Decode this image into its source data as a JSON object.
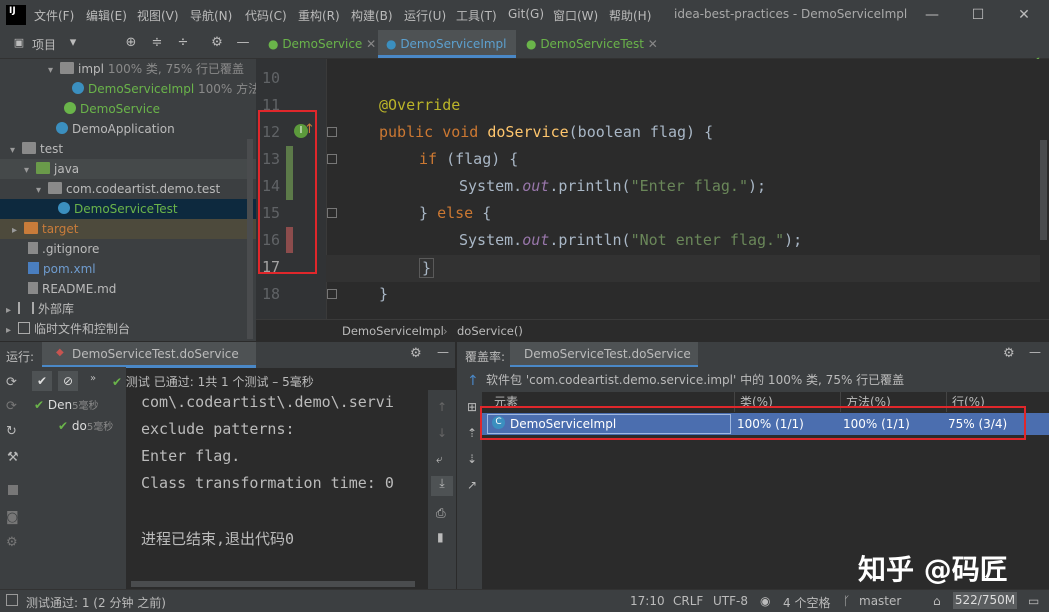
{
  "title_bar": {
    "menu": [
      "文件(F)",
      "编辑(E)",
      "视图(V)",
      "导航(N)",
      "代码(C)",
      "重构(R)",
      "构建(B)",
      "运行(U)",
      "工具(T)",
      "Git(G)",
      "窗口(W)",
      "帮助(H)"
    ],
    "window_title": "idea-best-practices - DemoServiceImpl"
  },
  "toolbar": {
    "project_label": "项目",
    "tabs": [
      "DemoService",
      "DemoServiceImpl",
      "DemoServiceTest"
    ],
    "active_tab": "DemoServiceImpl"
  },
  "project_tree": [
    {
      "label": "impl",
      "extra": "100% 类, 75% 行已覆盖",
      "type": "folder"
    },
    {
      "label": "DemoServiceImpl",
      "extra": "100% 方法",
      "type": "class"
    },
    {
      "label": "DemoService",
      "extra": "",
      "type": "interface"
    },
    {
      "label": "DemoApplication",
      "extra": "",
      "type": "spring"
    },
    {
      "label": "test",
      "extra": "",
      "type": "folder"
    },
    {
      "label": "java",
      "extra": "",
      "type": "folder-green"
    },
    {
      "label": "com.codeartist.demo.test",
      "extra": "",
      "type": "folder"
    },
    {
      "label": "DemoServiceTest",
      "extra": "",
      "type": "class"
    },
    {
      "label": "target",
      "extra": "",
      "type": "folder-orange"
    },
    {
      "label": ".gitignore",
      "extra": "",
      "type": "file"
    },
    {
      "label": "pom.xml",
      "extra": "",
      "type": "maven"
    },
    {
      "label": "README.md",
      "extra": "",
      "type": "file"
    },
    {
      "label": "外部库",
      "extra": "",
      "type": "lib"
    },
    {
      "label": "临时文件和控制台",
      "extra": "",
      "type": "lib"
    }
  ],
  "editor": {
    "line_numbers": [
      "10",
      "11",
      "12",
      "13",
      "14",
      "15",
      "16",
      "17",
      "18"
    ],
    "lines": {
      "l11": "@Override",
      "l12_kw1": "public",
      "l12_kw2": "void",
      "l12_fn": "doService",
      "l12_rest": "(boolean flag) {",
      "l13_kw": "if",
      "l13_rest": " (flag) {",
      "l14_a": "System.",
      "l14_b": "out",
      "l14_c": ".println(",
      "l14_str": "\"Enter flag.\"",
      "l14_end": ");",
      "l15_a": "} ",
      "l15_kw": "else",
      "l15_b": " {",
      "l16_a": "System.",
      "l16_b": "out",
      "l16_c": ".println(",
      "l16_str": "\"Not enter flag.\"",
      "l16_end": ");",
      "l17": "}",
      "l18": "}"
    },
    "breadcrumb": [
      "DemoServiceImpl",
      "doService()"
    ]
  },
  "run_panel": {
    "label": "运行:",
    "tab": "DemoServiceTest.doService",
    "status": "测试 已通过: 1共 1 个测试 – 5毫秒",
    "tree": [
      {
        "label": "Den",
        "time": "5毫秒"
      },
      {
        "label": "do",
        "time": "5毫秒"
      }
    ],
    "console": [
      "com\\.codeartist\\.demo\\.servi",
      "exclude patterns:",
      "Enter flag.",
      "Class transformation time: 0",
      "",
      "进程已结束,退出代码0"
    ]
  },
  "coverage_panel": {
    "label": "覆盖率:",
    "tab": "DemoServiceTest.doService",
    "summary": "软件包 'com.codeartist.demo.service.impl' 中的 100% 类, 75% 行已覆盖",
    "columns": [
      "元素",
      "类(%)",
      "方法(%)",
      "行(%)"
    ],
    "rows": [
      {
        "element": "DemoServiceImpl",
        "class": "100% (1/1)",
        "method": "100% (1/1)",
        "line": "75% (3/4)"
      }
    ]
  },
  "status_bar": {
    "message": "测试通过: 1 (2 分钟 之前)",
    "position": "17:10",
    "line_sep": "CRLF",
    "encoding": "UTF-8",
    "indent": "4 个空格",
    "branch": "master",
    "memory": "522/750M"
  },
  "watermark": "知乎 @码匠"
}
